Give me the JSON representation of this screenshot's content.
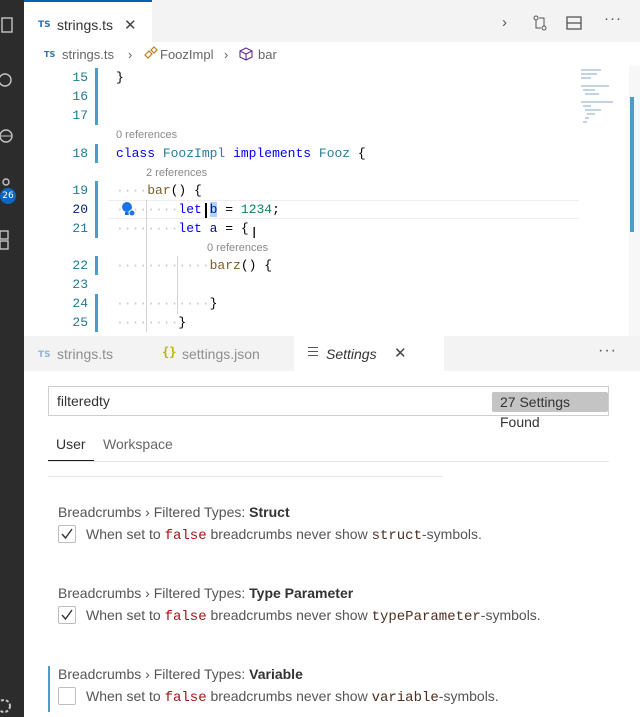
{
  "top_editor": {
    "tab": {
      "lang_badge": "TS",
      "title": "strings.ts",
      "close": "✕"
    },
    "breadcrumb": {
      "lang_badge": "TS",
      "file": "strings.ts",
      "class": "FoozImpl",
      "method": "bar",
      "sep": "›"
    },
    "line_numbers": [
      "15",
      "16",
      "17",
      "18",
      "19",
      "20",
      "21",
      "22",
      "23",
      "24",
      "25"
    ],
    "lenses": {
      "class_refs": "0 references",
      "bar_refs": "2 references",
      "barz_refs": "0 references"
    },
    "code": {
      "l15": "}",
      "class_kw": "class",
      "class_name": "FoozImpl",
      "implements_kw": "implements",
      "iface_name": "Fooz",
      "brace_open": "{",
      "bar_fn": "bar",
      "bar_rest": "() {",
      "let_kw": "let",
      "var_b": "b",
      "assign": "=",
      "num": "1234",
      "semi": ";",
      "var_a": "a",
      "assign_brace": "= {",
      "barz_fn": "barz",
      "barz_rest": "() {",
      "close_brace": "}"
    }
  },
  "bottom_editor": {
    "tabs": [
      {
        "lang_badge": "TS",
        "label": "strings.ts"
      },
      {
        "lang_badge": "{}",
        "label": "settings.json"
      },
      {
        "label": "Settings",
        "close": "✕"
      }
    ],
    "more": "···",
    "search": {
      "value": "filteredty",
      "count": "27 Settings Found"
    },
    "scopes": {
      "user": "User",
      "workspace": "Workspace"
    },
    "settings": [
      {
        "prefix": "Breadcrumbs › Filtered Types: ",
        "name": "Struct",
        "desc_pre": "When set to ",
        "desc_kw": "false",
        "desc_mid": " breadcrumbs never show ",
        "desc_sym": "struct",
        "desc_post": "-symbols.",
        "checked": true
      },
      {
        "prefix": "Breadcrumbs › Filtered Types: ",
        "name": "Type Parameter",
        "desc_pre": "When set to ",
        "desc_kw": "false",
        "desc_mid": " breadcrumbs never show ",
        "desc_sym": "typeParameter",
        "desc_post": "-symbols.",
        "checked": true
      },
      {
        "prefix": "Breadcrumbs › Filtered Types: ",
        "name": "Variable",
        "desc_pre": "When set to ",
        "desc_kw": "false",
        "desc_mid": " breadcrumbs never show ",
        "desc_sym": "variable",
        "desc_post": "-symbols.",
        "checked": false
      }
    ]
  },
  "activity": {
    "badge": "26"
  },
  "colors": {
    "accent": "#005fb8",
    "gutter": "#4a9dc9",
    "keyword": "#0000ff",
    "type": "#267f99",
    "number": "#098658",
    "string_kw": "#a31515"
  }
}
